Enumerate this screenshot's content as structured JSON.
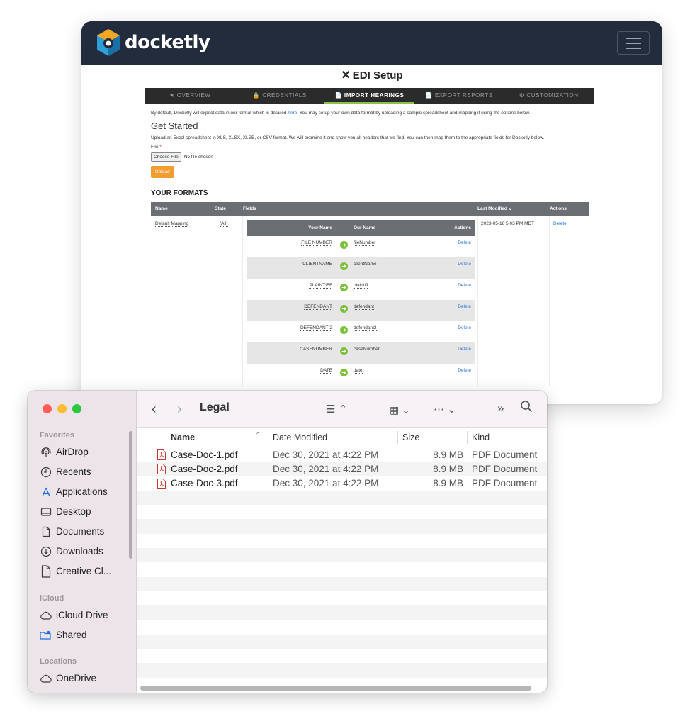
{
  "app": {
    "brand": "docketly",
    "title": "EDI Setup",
    "tabs": [
      {
        "label": "★ OVERVIEW",
        "active": false
      },
      {
        "label": "🔒 CREDENTIALS",
        "active": false
      },
      {
        "label": "📄 IMPORT HEARINGS",
        "active": true
      },
      {
        "label": "📄 EXPORT REPORTS",
        "active": false
      },
      {
        "label": "⚙ CUSTOMIZATION",
        "active": false
      }
    ],
    "intro_before": "By default, Docketly will expect data in our format which is detailed ",
    "intro_link": "here",
    "intro_after": ". You may setup your own data format by uploading a sample spreadsheet and mapping it using the options below.",
    "get_started_heading": "Get Started",
    "get_started_text": "Upload an Excel spreadsheet in XLS, XLSX, XLSB, or CSV format. We will examine it and show you all headers that we find. You can then map them to the appropriate fields for Docketly below.",
    "file_label": "File",
    "required_mark": "*",
    "choose_file_label": "Choose File",
    "no_file_text": "No file chosen",
    "upload_label": "Upload",
    "formats_heading": "YOUR FORMATS",
    "formats_columns": {
      "name": "Name",
      "state": "State",
      "fields": "Fields",
      "last_modified": "Last Modified ⌄",
      "actions": "Actions"
    },
    "format": {
      "name": "Default Mapping",
      "state": "(All)",
      "last_modified": "2023-05-16 5:03 PM MDT",
      "action": "Delete"
    },
    "mapping_columns": {
      "your_name": "Your Name",
      "our_name": "Our Name",
      "actions": "Actions"
    },
    "mappings": [
      {
        "your": "FILE NUMBER",
        "our": "fileNumber",
        "action": "Delete"
      },
      {
        "your": "CLIENTNAME",
        "our": "clientName",
        "action": "Delete"
      },
      {
        "your": "PLAINTIFF",
        "our": "plaintiff",
        "action": "Delete"
      },
      {
        "your": "DEFENDANT",
        "our": "defendant",
        "action": "Delete"
      },
      {
        "your": "DEFENDANT 2",
        "our": "defendant2",
        "action": "Delete"
      },
      {
        "your": "CASENUMBER",
        "our": "caseNumber",
        "action": "Delete"
      },
      {
        "your": "DATE",
        "our": "date",
        "action": "Delete"
      }
    ],
    "colors": {
      "header_bg": "#222c3c",
      "accent_green": "#8bc34a",
      "upload_orange": "#f39c32",
      "link_blue": "#1e6fd9"
    }
  },
  "finder": {
    "folder_title": "Legal",
    "sidebar": {
      "favorites_label": "Favorites",
      "favorites": [
        {
          "label": "AirDrop",
          "icon": "airdrop-icon"
        },
        {
          "label": "Recents",
          "icon": "clock-icon"
        },
        {
          "label": "Applications",
          "icon": "applications-icon"
        },
        {
          "label": "Desktop",
          "icon": "desktop-icon"
        },
        {
          "label": "Documents",
          "icon": "document-icon"
        },
        {
          "label": "Downloads",
          "icon": "download-icon"
        },
        {
          "label": "Creative Cl...",
          "icon": "file-icon"
        }
      ],
      "icloud_label": "iCloud",
      "icloud": [
        {
          "label": "iCloud Drive",
          "icon": "cloud-icon"
        },
        {
          "label": "Shared",
          "icon": "shared-folder-icon"
        }
      ],
      "locations_label": "Locations",
      "locations": [
        {
          "label": "OneDrive",
          "icon": "cloud-icon"
        }
      ]
    },
    "columns": {
      "name": "Name",
      "date": "Date Modified",
      "size": "Size",
      "kind": "Kind"
    },
    "files": [
      {
        "name": "Case-Doc-1.pdf",
        "date": "Dec 30, 2021 at 4:22 PM",
        "size": "8.9 MB",
        "kind": "PDF Document"
      },
      {
        "name": "Case-Doc-2.pdf",
        "date": "Dec 30, 2021 at 4:22 PM",
        "size": "8.9 MB",
        "kind": "PDF Document"
      },
      {
        "name": "Case-Doc-3.pdf",
        "date": "Dec 30, 2021 at 4:22 PM",
        "size": "8.9 MB",
        "kind": "PDF Document"
      }
    ]
  }
}
